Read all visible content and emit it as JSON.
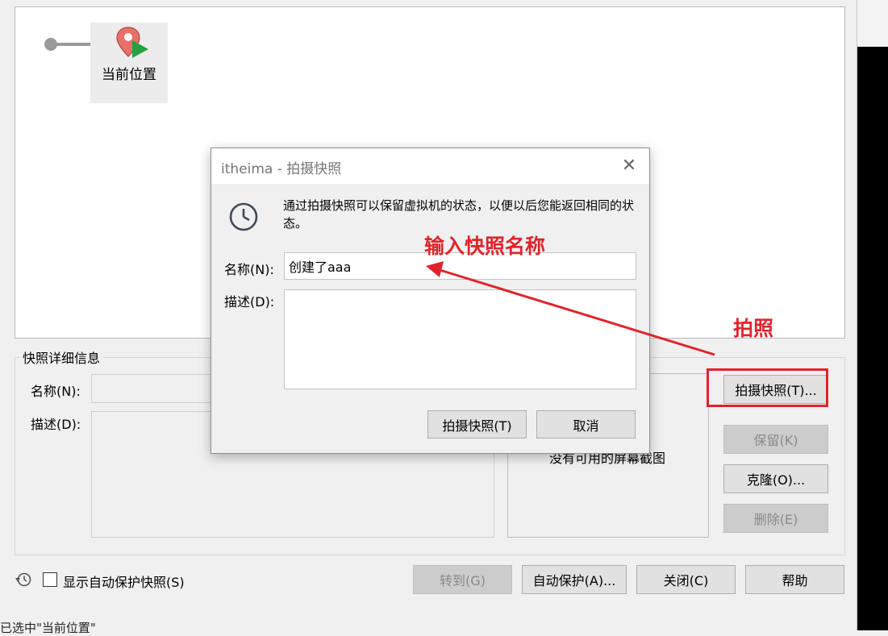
{
  "tree": {
    "node_label": "当前位置"
  },
  "details": {
    "group_title": "快照详细信息",
    "name_label": "名称(N):",
    "desc_label": "描述(D):",
    "no_screenshot": "没有可用的屏幕截图"
  },
  "side_buttons": {
    "take": "拍摄快照(T)...",
    "keep": "保留(K)",
    "clone": "克隆(O)...",
    "delete": "删除(E)"
  },
  "bottom": {
    "show_auto_protect": "显示自动保护快照(S)",
    "goto": "转到(G)",
    "auto_protect": "自动保护(A)...",
    "close": "关闭(C)",
    "help": "帮助"
  },
  "status_text": "已选中\"当前位置\"",
  "dialog": {
    "title": "itheima - 拍摄快照",
    "message": "通过拍摄快照可以保留虚拟机的状态，以便以后您能返回相同的状态。",
    "name_label": "名称(N):",
    "name_value": "创建了aaa",
    "desc_label": "描述(D):",
    "desc_value": "",
    "ok_button": "拍摄快照(T)",
    "cancel_button": "取消"
  },
  "annotations": {
    "input_hint": "输入快照名称",
    "take_hint": "拍照"
  },
  "colors": {
    "annotation_red": "#e0242b"
  }
}
